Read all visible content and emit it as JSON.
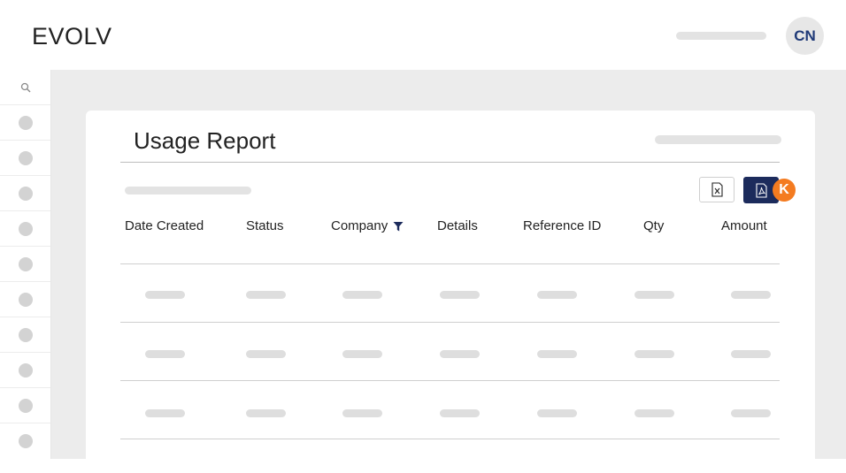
{
  "header": {
    "brand": "EVOLV",
    "avatar_initials": "CN"
  },
  "sidebar": {
    "items": [
      {
        "icon": "search-icon"
      },
      {
        "icon": "nav-dot-icon"
      },
      {
        "icon": "nav-dot-icon"
      },
      {
        "icon": "nav-dot-icon"
      },
      {
        "icon": "nav-dot-icon"
      },
      {
        "icon": "nav-dot-icon"
      },
      {
        "icon": "nav-dot-icon"
      },
      {
        "icon": "nav-dot-icon"
      },
      {
        "icon": "nav-dot-icon"
      },
      {
        "icon": "nav-dot-icon"
      },
      {
        "icon": "nav-dot-icon"
      }
    ]
  },
  "report": {
    "title": "Usage Report",
    "export_excel_icon": "excel-file-icon",
    "export_pdf_icon": "pdf-file-icon",
    "badge_label": "K",
    "columns": [
      "Date Created",
      "Status",
      "Company",
      "Details",
      "Reference ID",
      "Qty",
      "Amount"
    ],
    "filtered_column": "Company"
  },
  "colors": {
    "brand_navy": "#1c2b5c",
    "badge_orange": "#f47b20",
    "avatar_text": "#1f3a78"
  }
}
